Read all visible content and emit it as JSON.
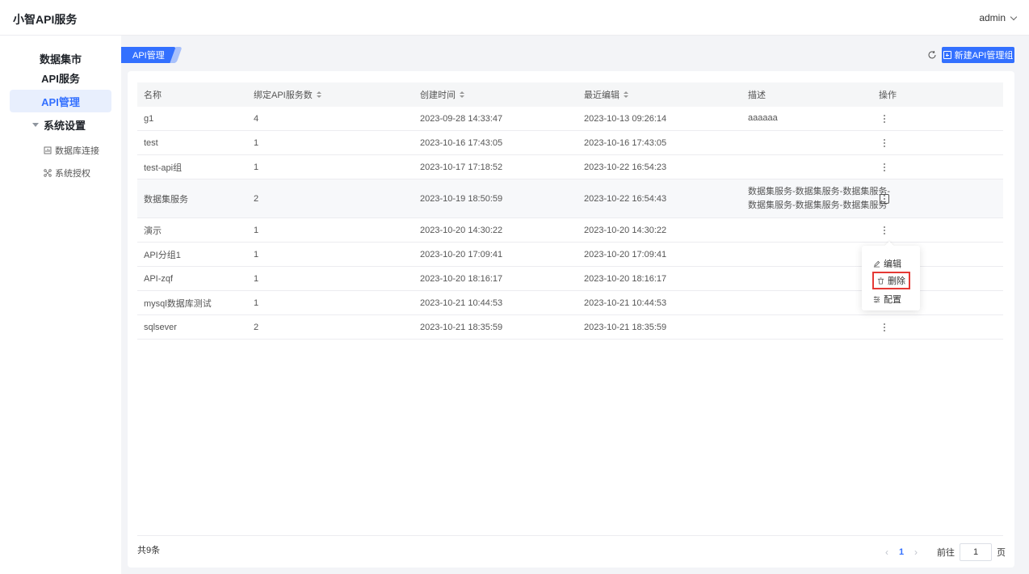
{
  "app": {
    "title": "小智API服务",
    "user": "admin"
  },
  "sidebar": {
    "items": [
      {
        "label": "数据集市"
      },
      {
        "label": "API服务"
      },
      {
        "label": "API管理"
      }
    ],
    "group": {
      "label": "系统设置",
      "children": [
        {
          "label": "数据库连接",
          "icon": "database-icon"
        },
        {
          "label": "系统授权",
          "icon": "network-icon"
        }
      ]
    }
  },
  "header": {
    "tab": "API管理",
    "new_button": "新建API管理组"
  },
  "table": {
    "columns": [
      "名称",
      "绑定API服务数",
      "创建时间",
      "最近编辑",
      "描述",
      "操作"
    ],
    "rows": [
      {
        "name": "g1",
        "count": "4",
        "created": "2023-09-28 14:33:47",
        "edited": "2023-10-13 09:26:14",
        "desc1": "aaaaaa",
        "desc2": ""
      },
      {
        "name": "test",
        "count": "1",
        "created": "2023-10-16 17:43:05",
        "edited": "2023-10-16 17:43:05",
        "desc1": "",
        "desc2": ""
      },
      {
        "name": "test-api组",
        "count": "1",
        "created": "2023-10-17 17:18:52",
        "edited": "2023-10-22 16:54:23",
        "desc1": "",
        "desc2": ""
      },
      {
        "name": "数据集服务",
        "count": "2",
        "created": "2023-10-19 18:50:59",
        "edited": "2023-10-22 16:54:43",
        "desc1": "数据集服务-数据集服务-数据集服务-",
        "desc2": "数据集服务-数据集服务-数据集服务"
      },
      {
        "name": "演示",
        "count": "1",
        "created": "2023-10-20 14:30:22",
        "edited": "2023-10-20 14:30:22",
        "desc1": "",
        "desc2": ""
      },
      {
        "name": "API分组1",
        "count": "1",
        "created": "2023-10-20 17:09:41",
        "edited": "2023-10-20 17:09:41",
        "desc1": "",
        "desc2": ""
      },
      {
        "name": "API-zqf",
        "count": "1",
        "created": "2023-10-20 18:16:17",
        "edited": "2023-10-20 18:16:17",
        "desc1": "",
        "desc2": ""
      },
      {
        "name": "mysql数据库测试",
        "count": "1",
        "created": "2023-10-21 10:44:53",
        "edited": "2023-10-21 10:44:53",
        "desc1": "",
        "desc2": ""
      },
      {
        "name": "sqlsever",
        "count": "2",
        "created": "2023-10-21 18:35:59",
        "edited": "2023-10-21 18:35:59",
        "desc1": "",
        "desc2": ""
      }
    ]
  },
  "dropdown": {
    "edit": "编辑",
    "delete": "删除",
    "config": "配置"
  },
  "footer": {
    "total": "共9条",
    "page": "1",
    "goto": "前往",
    "goto_value": "1",
    "page_suffix": "页"
  },
  "colors": {
    "accent": "#3370ff",
    "highlight": "#e53935"
  }
}
